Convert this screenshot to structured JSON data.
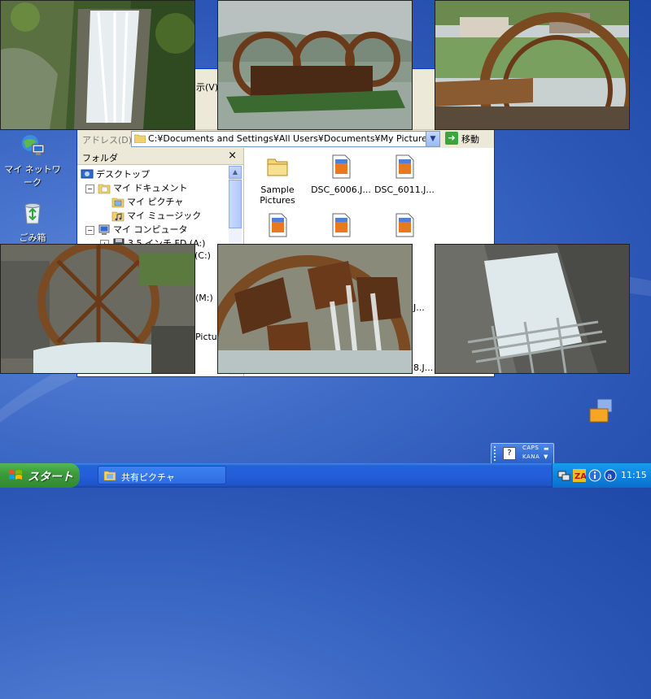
{
  "desktop": {
    "icons": [
      {
        "label": "マイ ネットワーク",
        "icon": "network-icon"
      },
      {
        "label": "ごみ箱",
        "icon": "recycle-bin-icon"
      }
    ]
  },
  "explorer": {
    "toolbar_fragment": "示(V)",
    "address": {
      "label": "アドレス(D)",
      "value": "C:¥Documents and Settings¥All Users¥Documents¥My Pictures",
      "go_label": "移動"
    },
    "folder_pane": {
      "title": "フォルダ",
      "close": "×",
      "tree": [
        {
          "label": "デスクトップ",
          "icon": "desktop-icon",
          "expander": ""
        },
        {
          "label": "マイ ドキュメント",
          "icon": "my-documents-icon",
          "expander": "−"
        },
        {
          "label": "マイ ピクチャ",
          "icon": "my-pictures-icon",
          "expander": ""
        },
        {
          "label": "マイ ミュージック",
          "icon": "my-music-icon",
          "expander": ""
        },
        {
          "label": "マイ コンピュータ",
          "icon": "my-computer-icon",
          "expander": "−"
        },
        {
          "label": "3.5 インチ FD (A:)",
          "icon": "floppy-icon",
          "expander": "+"
        }
      ],
      "fragments": [
        "(C:)",
        "(M:)",
        "Pictur"
      ]
    },
    "files": [
      {
        "label": "Sample Pictures",
        "icon": "folder-icon"
      },
      {
        "label": "DSC_6006.J...",
        "icon": "jpeg-file-icon"
      },
      {
        "label": "DSC_6011.J...",
        "icon": "jpeg-file-icon"
      },
      {
        "label": "",
        "icon": "jpeg-file-icon"
      },
      {
        "label": "",
        "icon": "jpeg-file-icon"
      },
      {
        "label": "",
        "icon": "jpeg-file-icon"
      }
    ],
    "file_fragments": [
      "J...",
      "8.J..."
    ]
  },
  "photos": [
    {
      "subject": "waterfall"
    },
    {
      "subject": "three-waterwheels"
    },
    {
      "subject": "waterwheel-village"
    },
    {
      "subject": "waterwheel-stone-channel"
    },
    {
      "subject": "waterwheel-closeup"
    },
    {
      "subject": "water-grate"
    }
  ],
  "taskbar": {
    "start_label": "スタート",
    "task_item_label": "共有ピクチャ",
    "clock": "11:15",
    "tray_icons": [
      "network-tray-icon",
      "zonealarm-icon",
      "info-icon",
      "antivirus-icon"
    ]
  },
  "language_bar": {
    "help": "?",
    "caps": "CAPS",
    "kana": "KANA"
  },
  "colors": {
    "taskbar_blue": "#245edb",
    "start_green": "#3c9c3c",
    "window_face": "#ece9d8",
    "desktop_blue": "#3a66c4"
  }
}
